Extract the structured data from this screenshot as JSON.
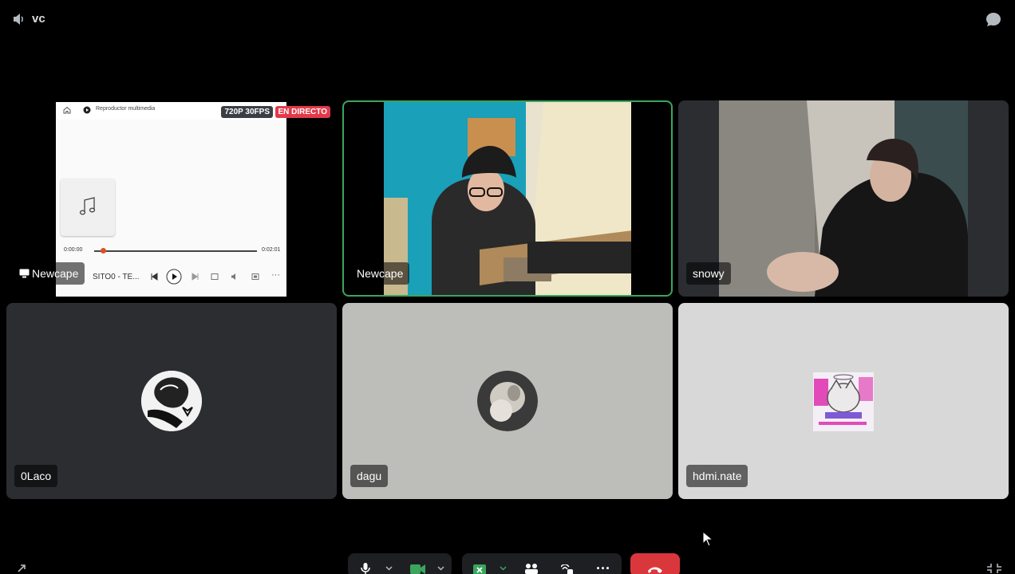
{
  "channel": {
    "title": "vc"
  },
  "icons": {
    "speaker": "speaker-icon",
    "chat": "chat-bubble-icon",
    "music": "music-note-icon",
    "monitor": "screen-share-icon",
    "mic": "microphone-icon",
    "camera": "camera-icon",
    "activity": "activity-icon",
    "soundboard": "soundboard-icon",
    "raise_hand": "raise-hand-icon",
    "more": "more-icon",
    "hangup": "hang-up-icon",
    "popout": "pop-out-icon",
    "fullscreen": "fullscreen-icon"
  },
  "stream": {
    "user": "Newcape",
    "quality_badge": "720P 30FPS",
    "live_badge": "EN DIRECTO",
    "app_title": "Reproductor multimedia",
    "song": "SITO0 - TE...",
    "time_elapsed": "0:00:00",
    "time_total": "0:02:01"
  },
  "participants": [
    {
      "name": "Newcape",
      "speaking": true
    },
    {
      "name": "snowy"
    },
    {
      "name": "0Laco"
    },
    {
      "name": "dagu"
    },
    {
      "name": "hdmi.nate"
    }
  ],
  "colors": {
    "speaking_border": "#3ba55d",
    "live_red": "#e33a4a",
    "hangup_red": "#da373c",
    "tile_dark": "#2b2d31",
    "tile_gray": "#bdbdb9",
    "tile_light": "#d8d8d8",
    "accent_green": "#3ba55d"
  }
}
